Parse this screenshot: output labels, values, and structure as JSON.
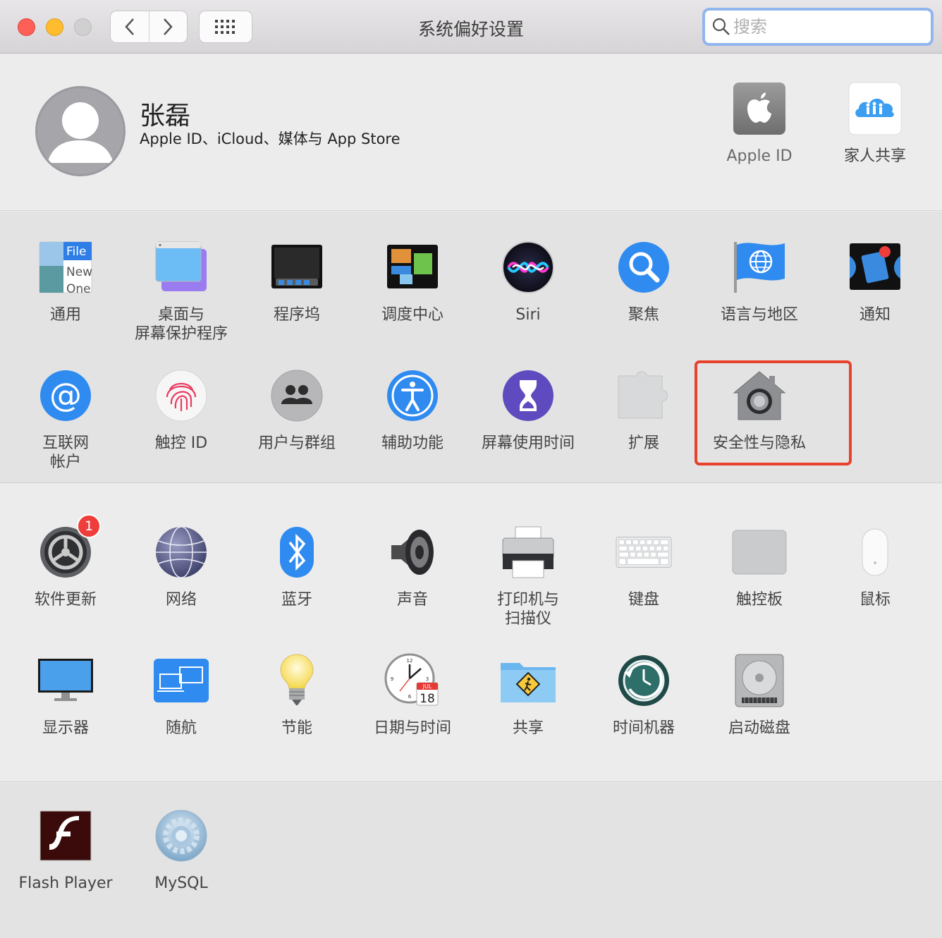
{
  "window": {
    "title": "系统偏好设置"
  },
  "search": {
    "placeholder": "搜索"
  },
  "user": {
    "name": "张磊",
    "subtitle": "Apple ID、iCloud、媒体与 App Store"
  },
  "account_items": [
    {
      "label": "Apple ID",
      "icon": "apple-icon"
    },
    {
      "label": "家人共享",
      "icon": "family-sharing-icon"
    }
  ],
  "section_a": [
    {
      "label": "通用",
      "icon": "general-icon"
    },
    {
      "label": "桌面与\n屏幕保护程序",
      "icon": "desktop-screensaver-icon"
    },
    {
      "label": "程序坞",
      "icon": "dock-icon"
    },
    {
      "label": "调度中心",
      "icon": "mission-control-icon"
    },
    {
      "label": "Siri",
      "icon": "siri-icon"
    },
    {
      "label": "聚焦",
      "icon": "spotlight-icon"
    },
    {
      "label": "语言与地区",
      "icon": "language-region-icon"
    },
    {
      "label": "通知",
      "icon": "notifications-icon"
    },
    {
      "label": "互联网\n帐户",
      "icon": "internet-accounts-icon"
    },
    {
      "label": "触控 ID",
      "icon": "touch-id-icon"
    },
    {
      "label": "用户与群组",
      "icon": "users-groups-icon"
    },
    {
      "label": "辅助功能",
      "icon": "accessibility-icon"
    },
    {
      "label": "屏幕使用时间",
      "icon": "screen-time-icon"
    },
    {
      "label": "扩展",
      "icon": "extensions-icon"
    },
    {
      "label": "安全性与隐私",
      "icon": "security-privacy-icon"
    }
  ],
  "section_b": [
    {
      "label": "软件更新",
      "icon": "software-update-icon",
      "badge": "1"
    },
    {
      "label": "网络",
      "icon": "network-icon"
    },
    {
      "label": "蓝牙",
      "icon": "bluetooth-icon"
    },
    {
      "label": "声音",
      "icon": "sound-icon"
    },
    {
      "label": "打印机与\n扫描仪",
      "icon": "printer-scanner-icon"
    },
    {
      "label": "键盘",
      "icon": "keyboard-icon"
    },
    {
      "label": "触控板",
      "icon": "trackpad-icon"
    },
    {
      "label": "鼠标",
      "icon": "mouse-icon"
    },
    {
      "label": "显示器",
      "icon": "displays-icon"
    },
    {
      "label": "随航",
      "icon": "sidecar-icon"
    },
    {
      "label": "节能",
      "icon": "energy-saver-icon"
    },
    {
      "label": "日期与时间",
      "icon": "date-time-icon"
    },
    {
      "label": "共享",
      "icon": "sharing-icon"
    },
    {
      "label": "时间机器",
      "icon": "time-machine-icon"
    },
    {
      "label": "启动磁盘",
      "icon": "startup-disk-icon"
    }
  ],
  "section_c": [
    {
      "label": "Flash Player",
      "icon": "flash-player-icon"
    },
    {
      "label": "MySQL",
      "icon": "mysql-icon"
    }
  ],
  "icon_text": {
    "general_line1": "File",
    "general_line2": "New",
    "general_line3": "One",
    "calendar_month": "JUL",
    "calendar_day": "18"
  },
  "colors": {
    "highlight": "#e8412d",
    "search_focus": "#91b6ee",
    "badge": "#ee3d3a"
  }
}
